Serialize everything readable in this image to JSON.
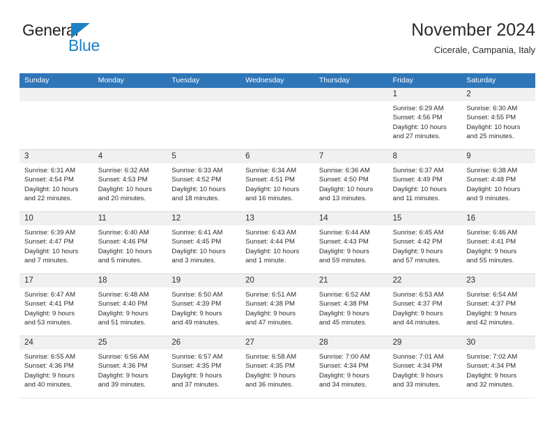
{
  "brand": {
    "line1": "General",
    "line2": "Blue",
    "accent_color": "#1d7fc4"
  },
  "header": {
    "title": "November 2024",
    "subtitle": "Cicerale, Campania, Italy"
  },
  "theme": {
    "header_blue": "#2e76b8",
    "daynum_gray": "#f0f0f0",
    "text": "#2b2b2b"
  },
  "weekdays": [
    "Sunday",
    "Monday",
    "Tuesday",
    "Wednesday",
    "Thursday",
    "Friday",
    "Saturday"
  ],
  "weeks": [
    [
      {
        "day": "",
        "lines": []
      },
      {
        "day": "",
        "lines": []
      },
      {
        "day": "",
        "lines": []
      },
      {
        "day": "",
        "lines": []
      },
      {
        "day": "",
        "lines": []
      },
      {
        "day": "1",
        "lines": [
          "Sunrise: 6:29 AM",
          "Sunset: 4:56 PM",
          "Daylight: 10 hours",
          "and 27 minutes."
        ]
      },
      {
        "day": "2",
        "lines": [
          "Sunrise: 6:30 AM",
          "Sunset: 4:55 PM",
          "Daylight: 10 hours",
          "and 25 minutes."
        ]
      }
    ],
    [
      {
        "day": "3",
        "lines": [
          "Sunrise: 6:31 AM",
          "Sunset: 4:54 PM",
          "Daylight: 10 hours",
          "and 22 minutes."
        ]
      },
      {
        "day": "4",
        "lines": [
          "Sunrise: 6:32 AM",
          "Sunset: 4:53 PM",
          "Daylight: 10 hours",
          "and 20 minutes."
        ]
      },
      {
        "day": "5",
        "lines": [
          "Sunrise: 6:33 AM",
          "Sunset: 4:52 PM",
          "Daylight: 10 hours",
          "and 18 minutes."
        ]
      },
      {
        "day": "6",
        "lines": [
          "Sunrise: 6:34 AM",
          "Sunset: 4:51 PM",
          "Daylight: 10 hours",
          "and 16 minutes."
        ]
      },
      {
        "day": "7",
        "lines": [
          "Sunrise: 6:36 AM",
          "Sunset: 4:50 PM",
          "Daylight: 10 hours",
          "and 13 minutes."
        ]
      },
      {
        "day": "8",
        "lines": [
          "Sunrise: 6:37 AM",
          "Sunset: 4:49 PM",
          "Daylight: 10 hours",
          "and 11 minutes."
        ]
      },
      {
        "day": "9",
        "lines": [
          "Sunrise: 6:38 AM",
          "Sunset: 4:48 PM",
          "Daylight: 10 hours",
          "and 9 minutes."
        ]
      }
    ],
    [
      {
        "day": "10",
        "lines": [
          "Sunrise: 6:39 AM",
          "Sunset: 4:47 PM",
          "Daylight: 10 hours",
          "and 7 minutes."
        ]
      },
      {
        "day": "11",
        "lines": [
          "Sunrise: 6:40 AM",
          "Sunset: 4:46 PM",
          "Daylight: 10 hours",
          "and 5 minutes."
        ]
      },
      {
        "day": "12",
        "lines": [
          "Sunrise: 6:41 AM",
          "Sunset: 4:45 PM",
          "Daylight: 10 hours",
          "and 3 minutes."
        ]
      },
      {
        "day": "13",
        "lines": [
          "Sunrise: 6:43 AM",
          "Sunset: 4:44 PM",
          "Daylight: 10 hours",
          "and 1 minute."
        ]
      },
      {
        "day": "14",
        "lines": [
          "Sunrise: 6:44 AM",
          "Sunset: 4:43 PM",
          "Daylight: 9 hours",
          "and 59 minutes."
        ]
      },
      {
        "day": "15",
        "lines": [
          "Sunrise: 6:45 AM",
          "Sunset: 4:42 PM",
          "Daylight: 9 hours",
          "and 57 minutes."
        ]
      },
      {
        "day": "16",
        "lines": [
          "Sunrise: 6:46 AM",
          "Sunset: 4:41 PM",
          "Daylight: 9 hours",
          "and 55 minutes."
        ]
      }
    ],
    [
      {
        "day": "17",
        "lines": [
          "Sunrise: 6:47 AM",
          "Sunset: 4:41 PM",
          "Daylight: 9 hours",
          "and 53 minutes."
        ]
      },
      {
        "day": "18",
        "lines": [
          "Sunrise: 6:48 AM",
          "Sunset: 4:40 PM",
          "Daylight: 9 hours",
          "and 51 minutes."
        ]
      },
      {
        "day": "19",
        "lines": [
          "Sunrise: 6:50 AM",
          "Sunset: 4:39 PM",
          "Daylight: 9 hours",
          "and 49 minutes."
        ]
      },
      {
        "day": "20",
        "lines": [
          "Sunrise: 6:51 AM",
          "Sunset: 4:38 PM",
          "Daylight: 9 hours",
          "and 47 minutes."
        ]
      },
      {
        "day": "21",
        "lines": [
          "Sunrise: 6:52 AM",
          "Sunset: 4:38 PM",
          "Daylight: 9 hours",
          "and 45 minutes."
        ]
      },
      {
        "day": "22",
        "lines": [
          "Sunrise: 6:53 AM",
          "Sunset: 4:37 PM",
          "Daylight: 9 hours",
          "and 44 minutes."
        ]
      },
      {
        "day": "23",
        "lines": [
          "Sunrise: 6:54 AM",
          "Sunset: 4:37 PM",
          "Daylight: 9 hours",
          "and 42 minutes."
        ]
      }
    ],
    [
      {
        "day": "24",
        "lines": [
          "Sunrise: 6:55 AM",
          "Sunset: 4:36 PM",
          "Daylight: 9 hours",
          "and 40 minutes."
        ]
      },
      {
        "day": "25",
        "lines": [
          "Sunrise: 6:56 AM",
          "Sunset: 4:36 PM",
          "Daylight: 9 hours",
          "and 39 minutes."
        ]
      },
      {
        "day": "26",
        "lines": [
          "Sunrise: 6:57 AM",
          "Sunset: 4:35 PM",
          "Daylight: 9 hours",
          "and 37 minutes."
        ]
      },
      {
        "day": "27",
        "lines": [
          "Sunrise: 6:58 AM",
          "Sunset: 4:35 PM",
          "Daylight: 9 hours",
          "and 36 minutes."
        ]
      },
      {
        "day": "28",
        "lines": [
          "Sunrise: 7:00 AM",
          "Sunset: 4:34 PM",
          "Daylight: 9 hours",
          "and 34 minutes."
        ]
      },
      {
        "day": "29",
        "lines": [
          "Sunrise: 7:01 AM",
          "Sunset: 4:34 PM",
          "Daylight: 9 hours",
          "and 33 minutes."
        ]
      },
      {
        "day": "30",
        "lines": [
          "Sunrise: 7:02 AM",
          "Sunset: 4:34 PM",
          "Daylight: 9 hours",
          "and 32 minutes."
        ]
      }
    ]
  ]
}
